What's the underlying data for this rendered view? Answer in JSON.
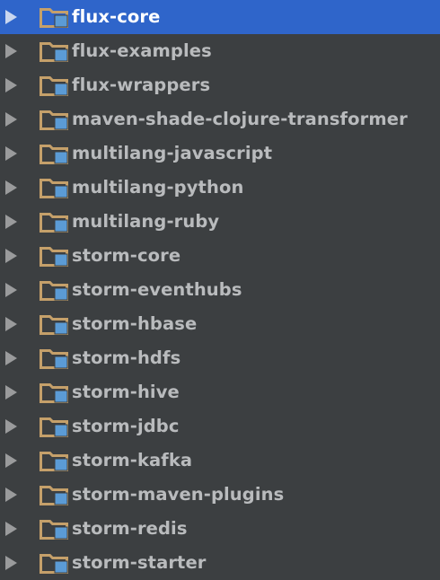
{
  "tree": {
    "items": [
      {
        "label": "flux-core",
        "selected": true,
        "icon": "module-folder-icon"
      },
      {
        "label": "flux-examples",
        "selected": false,
        "icon": "module-folder-icon"
      },
      {
        "label": "flux-wrappers",
        "selected": false,
        "icon": "module-folder-icon"
      },
      {
        "label": "maven-shade-clojure-transformer",
        "selected": false,
        "icon": "module-folder-icon"
      },
      {
        "label": "multilang-javascript",
        "selected": false,
        "icon": "module-folder-icon"
      },
      {
        "label": "multilang-python",
        "selected": false,
        "icon": "module-folder-icon"
      },
      {
        "label": "multilang-ruby",
        "selected": false,
        "icon": "module-folder-icon"
      },
      {
        "label": "storm-core",
        "selected": false,
        "icon": "module-folder-icon"
      },
      {
        "label": "storm-eventhubs",
        "selected": false,
        "icon": "module-folder-icon"
      },
      {
        "label": "storm-hbase",
        "selected": false,
        "icon": "module-folder-icon"
      },
      {
        "label": "storm-hdfs",
        "selected": false,
        "icon": "module-folder-icon"
      },
      {
        "label": "storm-hive",
        "selected": false,
        "icon": "module-folder-icon"
      },
      {
        "label": "storm-jdbc",
        "selected": false,
        "icon": "module-folder-icon"
      },
      {
        "label": "storm-kafka",
        "selected": false,
        "icon": "module-folder-icon"
      },
      {
        "label": "storm-maven-plugins",
        "selected": false,
        "icon": "module-folder-icon"
      },
      {
        "label": "storm-redis",
        "selected": false,
        "icon": "module-folder-icon"
      },
      {
        "label": "storm-starter",
        "selected": false,
        "icon": "module-folder-icon"
      }
    ]
  },
  "colors": {
    "background": "#3c3f41",
    "selection": "#2f65ca",
    "text": "#b9bbbd",
    "selected_text": "#ffffff",
    "folder": "#c5a06a",
    "module_badge": "#5b9bd5"
  }
}
